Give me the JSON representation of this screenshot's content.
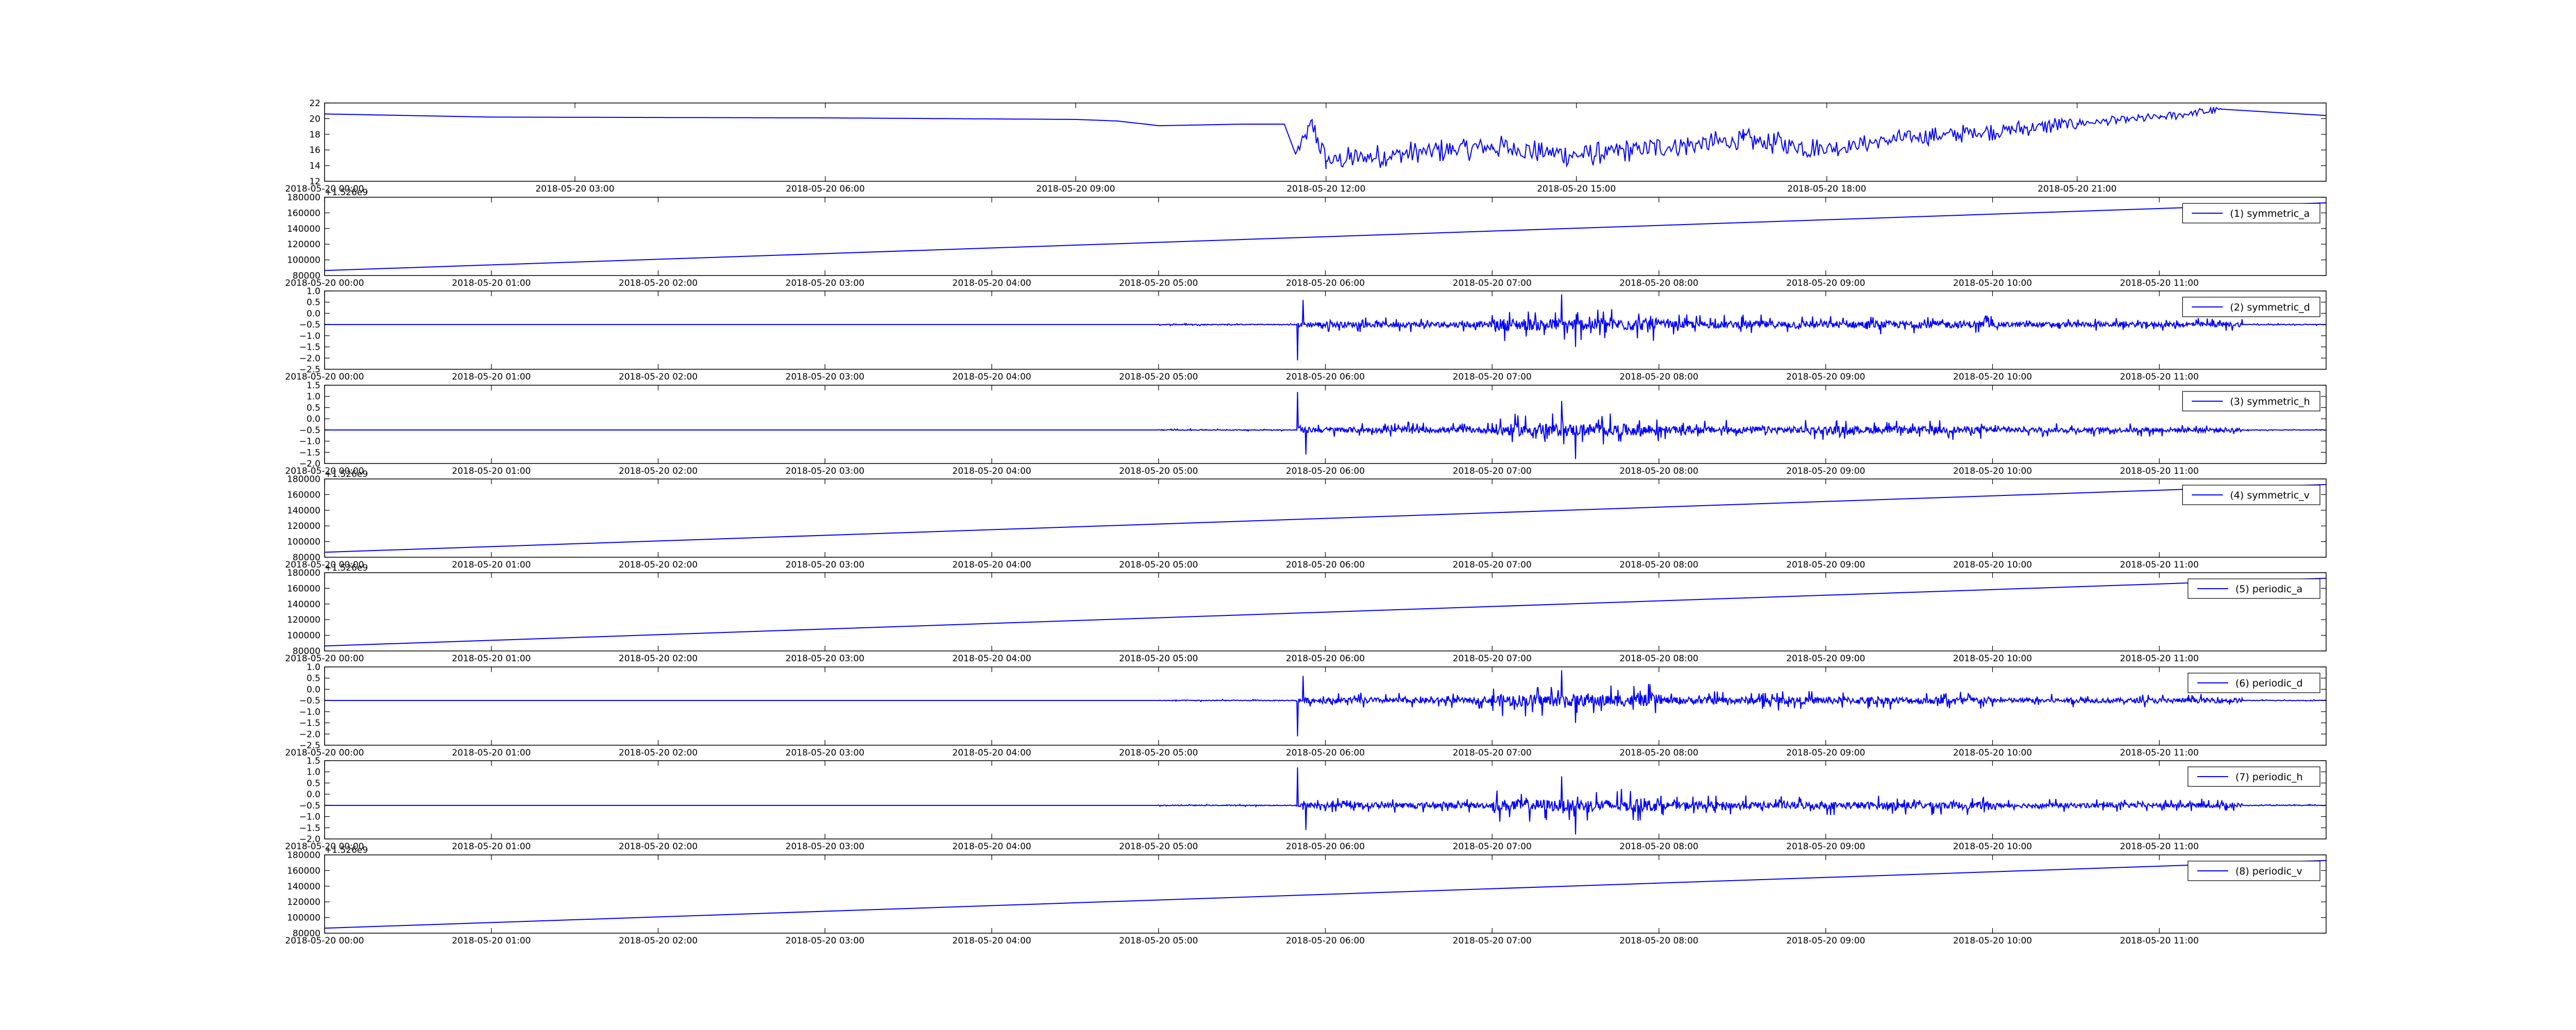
{
  "figure": {
    "background": "#ffffff",
    "line_color": "#0000ff"
  },
  "chart_data": [
    {
      "type": "line",
      "x_axis": "datetime",
      "xlim": [
        "2018-05-20 00:00",
        "2018-05-20 23:59"
      ],
      "xticks": [
        "2018-05-20 00:00",
        "2018-05-20 03:00",
        "2018-05-20 06:00",
        "2018-05-20 09:00",
        "2018-05-20 12:00",
        "2018-05-20 15:00",
        "2018-05-20 18:00",
        "2018-05-20 21:00"
      ],
      "ylim": [
        12,
        22
      ],
      "yticks": [
        "12",
        "14",
        "16",
        "18",
        "20",
        "22"
      ],
      "offset_text": "",
      "legend": "",
      "grid": false,
      "series": [
        {
          "color": "#0000ff",
          "points": [
            [
              "2018-05-20 00:00",
              20.6
            ],
            [
              "2018-05-20 02:00",
              20.2
            ],
            [
              "2018-05-20 06:00",
              20.1
            ],
            [
              "2018-05-20 09:00",
              19.9
            ],
            [
              "2018-05-20 09:30",
              19.7
            ],
            [
              "2018-05-20 10:00",
              19.1
            ],
            [
              "2018-05-20 11:00",
              19.3
            ],
            [
              "2018-05-20 11:30",
              19.3
            ],
            [
              "2018-05-20 11:38",
              15.5
            ],
            [
              "2018-05-20 11:50",
              19.2
            ],
            [
              "2018-05-20 12:00",
              14.6
            ],
            [
              "2018-05-20 13:00",
              15.6
            ],
            [
              "2018-05-20 14:00",
              16.4
            ],
            [
              "2018-05-20 15:00",
              15.3
            ],
            [
              "2018-05-20 16:00",
              16.3
            ],
            [
              "2018-05-20 17:00",
              17.2
            ],
            [
              "2018-05-20 18:00",
              16.2
            ],
            [
              "2018-05-20 19:00",
              17.6
            ],
            [
              "2018-05-20 20:00",
              18.4
            ],
            [
              "2018-05-20 21:00",
              19.4
            ],
            [
              "2018-05-20 22:00",
              20.2
            ],
            [
              "2018-05-20 22:45",
              21.2
            ],
            [
              "2018-05-20 23:59",
              20.4
            ]
          ],
          "noise": [
            {
              "from": "2018-05-20 11:40",
              "to": "2018-05-20 18:00",
              "amplitude": 1.6
            },
            {
              "from": "2018-05-20 18:00",
              "to": "2018-05-20 21:00",
              "amplitude": 1.2
            },
            {
              "from": "2018-05-20 21:00",
              "to": "2018-05-20 22:45",
              "amplitude": 0.6
            }
          ]
        }
      ]
    },
    {
      "type": "line",
      "x_axis": "datetime",
      "xlim": [
        "2018-05-20 00:00",
        "2018-05-20 12:00"
      ],
      "xticks": [
        "2018-05-20 00:00",
        "2018-05-20 01:00",
        "2018-05-20 02:00",
        "2018-05-20 03:00",
        "2018-05-20 04:00",
        "2018-05-20 05:00",
        "2018-05-20 06:00",
        "2018-05-20 07:00",
        "2018-05-20 08:00",
        "2018-05-20 09:00",
        "2018-05-20 10:00",
        "2018-05-20 11:00"
      ],
      "ylim": [
        80000,
        180000
      ],
      "yticks": [
        "80000",
        "100000",
        "120000",
        "140000",
        "160000",
        "180000"
      ],
      "offset_text": "+1.526e9",
      "legend": "(1) symmetric_a",
      "grid": false,
      "series": [
        {
          "name": "(1) symmetric_a",
          "color": "#0000ff",
          "points": [
            [
              "2018-05-20 00:00",
              86400
            ],
            [
              "2018-05-20 12:00",
              172800
            ]
          ]
        }
      ]
    },
    {
      "type": "line",
      "x_axis": "datetime",
      "xlim": [
        "2018-05-20 00:00",
        "2018-05-20 12:00"
      ],
      "xticks": [
        "2018-05-20 00:00",
        "2018-05-20 01:00",
        "2018-05-20 02:00",
        "2018-05-20 03:00",
        "2018-05-20 04:00",
        "2018-05-20 05:00",
        "2018-05-20 06:00",
        "2018-05-20 07:00",
        "2018-05-20 08:00",
        "2018-05-20 09:00",
        "2018-05-20 10:00",
        "2018-05-20 11:00"
      ],
      "ylim": [
        -2.5,
        1.0
      ],
      "yticks": [
        "−2.5",
        "−2.0",
        "−1.5",
        "−1.0",
        "−0.5",
        "0.0",
        "0.5",
        "1.0"
      ],
      "offset_text": "",
      "legend": "(2) symmetric_d",
      "grid": false,
      "series": [
        {
          "name": "(2) symmetric_d",
          "color": "#0000ff",
          "baseline": -0.5,
          "spikes": [
            [
              "2018-05-20 05:50",
              -2.1
            ],
            [
              "2018-05-20 05:52",
              0.6
            ],
            [
              "2018-05-20 07:25",
              0.85
            ],
            [
              "2018-05-20 07:30",
              -1.5
            ]
          ],
          "noise": [
            {
              "from": "2018-05-20 05:00",
              "to": "2018-05-20 05:50",
              "amplitude": 0.05
            },
            {
              "from": "2018-05-20 05:50",
              "to": "2018-05-20 07:00",
              "amplitude": 0.35
            },
            {
              "from": "2018-05-20 07:00",
              "to": "2018-05-20 08:00",
              "amplitude": 0.75
            },
            {
              "from": "2018-05-20 08:00",
              "to": "2018-05-20 10:00",
              "amplitude": 0.45
            },
            {
              "from": "2018-05-20 10:00",
              "to": "2018-05-20 11:30",
              "amplitude": 0.3
            },
            {
              "from": "2018-05-20 11:30",
              "to": "2018-05-20 12:00",
              "amplitude": 0.04
            }
          ]
        }
      ]
    },
    {
      "type": "line",
      "x_axis": "datetime",
      "xlim": [
        "2018-05-20 00:00",
        "2018-05-20 12:00"
      ],
      "xticks": [
        "2018-05-20 00:00",
        "2018-05-20 01:00",
        "2018-05-20 02:00",
        "2018-05-20 03:00",
        "2018-05-20 04:00",
        "2018-05-20 05:00",
        "2018-05-20 06:00",
        "2018-05-20 07:00",
        "2018-05-20 08:00",
        "2018-05-20 09:00",
        "2018-05-20 10:00",
        "2018-05-20 11:00"
      ],
      "ylim": [
        -2.0,
        1.5
      ],
      "yticks": [
        "−2.0",
        "−1.5",
        "−1.0",
        "−0.5",
        "0.0",
        "0.5",
        "1.0",
        "1.5"
      ],
      "offset_text": "",
      "legend": "(3) symmetric_h",
      "grid": false,
      "series": [
        {
          "name": "(3) symmetric_h",
          "color": "#0000ff",
          "baseline": -0.5,
          "spikes": [
            [
              "2018-05-20 05:50",
              1.2
            ],
            [
              "2018-05-20 05:53",
              -1.6
            ],
            [
              "2018-05-20 07:25",
              0.8
            ],
            [
              "2018-05-20 07:30",
              -1.8
            ]
          ],
          "noise": [
            {
              "from": "2018-05-20 05:00",
              "to": "2018-05-20 05:50",
              "amplitude": 0.05
            },
            {
              "from": "2018-05-20 05:50",
              "to": "2018-05-20 07:00",
              "amplitude": 0.35
            },
            {
              "from": "2018-05-20 07:00",
              "to": "2018-05-20 08:00",
              "amplitude": 0.75
            },
            {
              "from": "2018-05-20 08:00",
              "to": "2018-05-20 10:00",
              "amplitude": 0.45
            },
            {
              "from": "2018-05-20 10:00",
              "to": "2018-05-20 11:30",
              "amplitude": 0.3
            },
            {
              "from": "2018-05-20 11:30",
              "to": "2018-05-20 12:00",
              "amplitude": 0.04
            }
          ]
        }
      ]
    },
    {
      "type": "line",
      "x_axis": "datetime",
      "xlim": [
        "2018-05-20 00:00",
        "2018-05-20 12:00"
      ],
      "xticks": [
        "2018-05-20 00:00",
        "2018-05-20 01:00",
        "2018-05-20 02:00",
        "2018-05-20 03:00",
        "2018-05-20 04:00",
        "2018-05-20 05:00",
        "2018-05-20 06:00",
        "2018-05-20 07:00",
        "2018-05-20 08:00",
        "2018-05-20 09:00",
        "2018-05-20 10:00",
        "2018-05-20 11:00"
      ],
      "ylim": [
        80000,
        180000
      ],
      "yticks": [
        "80000",
        "100000",
        "120000",
        "140000",
        "160000",
        "180000"
      ],
      "offset_text": "+1.526e9",
      "legend": "(4) symmetric_v",
      "grid": false,
      "series": [
        {
          "name": "(4) symmetric_v",
          "color": "#0000ff",
          "points": [
            [
              "2018-05-20 00:00",
              86400
            ],
            [
              "2018-05-20 12:00",
              172800
            ]
          ]
        }
      ]
    },
    {
      "type": "line",
      "x_axis": "datetime",
      "xlim": [
        "2018-05-20 00:00",
        "2018-05-20 12:00"
      ],
      "xticks": [
        "2018-05-20 00:00",
        "2018-05-20 01:00",
        "2018-05-20 02:00",
        "2018-05-20 03:00",
        "2018-05-20 04:00",
        "2018-05-20 05:00",
        "2018-05-20 06:00",
        "2018-05-20 07:00",
        "2018-05-20 08:00",
        "2018-05-20 09:00",
        "2018-05-20 10:00",
        "2018-05-20 11:00"
      ],
      "ylim": [
        80000,
        180000
      ],
      "yticks": [
        "80000",
        "100000",
        "120000",
        "140000",
        "160000",
        "180000"
      ],
      "offset_text": "+1.526e9",
      "legend": "(5) periodic_a",
      "grid": false,
      "series": [
        {
          "name": "(5) periodic_a",
          "color": "#0000ff",
          "points": [
            [
              "2018-05-20 00:00",
              86400
            ],
            [
              "2018-05-20 12:00",
              172800
            ]
          ]
        }
      ]
    },
    {
      "type": "line",
      "x_axis": "datetime",
      "xlim": [
        "2018-05-20 00:00",
        "2018-05-20 12:00"
      ],
      "xticks": [
        "2018-05-20 00:00",
        "2018-05-20 01:00",
        "2018-05-20 02:00",
        "2018-05-20 03:00",
        "2018-05-20 04:00",
        "2018-05-20 05:00",
        "2018-05-20 06:00",
        "2018-05-20 07:00",
        "2018-05-20 08:00",
        "2018-05-20 09:00",
        "2018-05-20 10:00",
        "2018-05-20 11:00"
      ],
      "ylim": [
        -2.5,
        1.0
      ],
      "yticks": [
        "−2.5",
        "−2.0",
        "−1.5",
        "−1.0",
        "−0.5",
        "0.0",
        "0.5",
        "1.0"
      ],
      "offset_text": "",
      "legend": "(6) periodic_d",
      "grid": false,
      "series": [
        {
          "name": "(6) periodic_d",
          "color": "#0000ff",
          "baseline": -0.5,
          "spikes": [
            [
              "2018-05-20 05:50",
              -2.1
            ],
            [
              "2018-05-20 05:52",
              0.6
            ],
            [
              "2018-05-20 07:25",
              0.85
            ],
            [
              "2018-05-20 07:30",
              -1.5
            ]
          ],
          "noise": [
            {
              "from": "2018-05-20 05:00",
              "to": "2018-05-20 05:50",
              "amplitude": 0.05
            },
            {
              "from": "2018-05-20 05:50",
              "to": "2018-05-20 07:00",
              "amplitude": 0.35
            },
            {
              "from": "2018-05-20 07:00",
              "to": "2018-05-20 08:00",
              "amplitude": 0.75
            },
            {
              "from": "2018-05-20 08:00",
              "to": "2018-05-20 10:00",
              "amplitude": 0.45
            },
            {
              "from": "2018-05-20 10:00",
              "to": "2018-05-20 11:30",
              "amplitude": 0.3
            },
            {
              "from": "2018-05-20 11:30",
              "to": "2018-05-20 12:00",
              "amplitude": 0.04
            }
          ]
        }
      ]
    },
    {
      "type": "line",
      "x_axis": "datetime",
      "xlim": [
        "2018-05-20 00:00",
        "2018-05-20 12:00"
      ],
      "xticks": [
        "2018-05-20 00:00",
        "2018-05-20 01:00",
        "2018-05-20 02:00",
        "2018-05-20 03:00",
        "2018-05-20 04:00",
        "2018-05-20 05:00",
        "2018-05-20 06:00",
        "2018-05-20 07:00",
        "2018-05-20 08:00",
        "2018-05-20 09:00",
        "2018-05-20 10:00",
        "2018-05-20 11:00"
      ],
      "ylim": [
        -2.0,
        1.5
      ],
      "yticks": [
        "−2.0",
        "−1.5",
        "−1.0",
        "−0.5",
        "0.0",
        "0.5",
        "1.0",
        "1.5"
      ],
      "offset_text": "",
      "legend": "(7) periodic_h",
      "grid": false,
      "series": [
        {
          "name": "(7) periodic_h",
          "color": "#0000ff",
          "baseline": -0.5,
          "spikes": [
            [
              "2018-05-20 05:50",
              1.2
            ],
            [
              "2018-05-20 05:53",
              -1.6
            ],
            [
              "2018-05-20 07:25",
              0.8
            ],
            [
              "2018-05-20 07:30",
              -1.8
            ]
          ],
          "noise": [
            {
              "from": "2018-05-20 05:00",
              "to": "2018-05-20 05:50",
              "amplitude": 0.05
            },
            {
              "from": "2018-05-20 05:50",
              "to": "2018-05-20 07:00",
              "amplitude": 0.35
            },
            {
              "from": "2018-05-20 07:00",
              "to": "2018-05-20 08:00",
              "amplitude": 0.75
            },
            {
              "from": "2018-05-20 08:00",
              "to": "2018-05-20 10:00",
              "amplitude": 0.45
            },
            {
              "from": "2018-05-20 10:00",
              "to": "2018-05-20 11:30",
              "amplitude": 0.3
            },
            {
              "from": "2018-05-20 11:30",
              "to": "2018-05-20 12:00",
              "amplitude": 0.04
            }
          ]
        }
      ]
    },
    {
      "type": "line",
      "x_axis": "datetime",
      "xlim": [
        "2018-05-20 00:00",
        "2018-05-20 12:00"
      ],
      "xticks": [
        "2018-05-20 00:00",
        "2018-05-20 01:00",
        "2018-05-20 02:00",
        "2018-05-20 03:00",
        "2018-05-20 04:00",
        "2018-05-20 05:00",
        "2018-05-20 06:00",
        "2018-05-20 07:00",
        "2018-05-20 08:00",
        "2018-05-20 09:00",
        "2018-05-20 10:00",
        "2018-05-20 11:00"
      ],
      "ylim": [
        80000,
        180000
      ],
      "yticks": [
        "80000",
        "100000",
        "120000",
        "140000",
        "160000",
        "180000"
      ],
      "offset_text": "+1.526e9",
      "legend": "(8) periodic_v",
      "grid": false,
      "series": [
        {
          "name": "(8) periodic_v",
          "color": "#0000ff",
          "points": [
            [
              "2018-05-20 00:00",
              86400
            ],
            [
              "2018-05-20 12:00",
              172800
            ]
          ]
        }
      ]
    }
  ]
}
